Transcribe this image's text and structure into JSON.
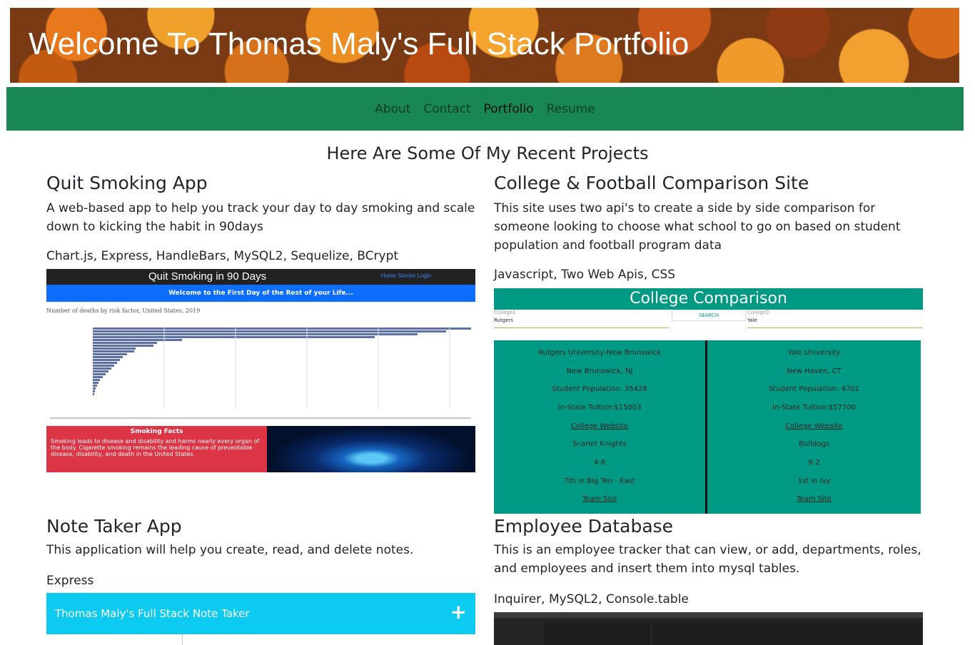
{
  "banner": {
    "title": "Welcome To Thomas Maly's Full Stack Portfolio"
  },
  "nav": {
    "items": [
      "About",
      "Contact",
      "Portfolio",
      "Resume"
    ]
  },
  "section_title": "Here Are Some Of My Recent Projects",
  "projects": [
    {
      "title": "Quit Smoking App",
      "description": "A web-based app to help you track your day to day smoking and scale down to kicking the habit in 90days",
      "tech": "Chart.js, Express, HandleBars, MySQL2, Sequelize, BCrypt"
    },
    {
      "title": "College & Football Comparison Site",
      "description": "This site uses two api's to create a side by side comparison for someone looking to choose what school to go on based on student population and football program data",
      "tech": "Javascript, Two Web Apis, CSS"
    },
    {
      "title": "Note Taker App",
      "description": "This application will help you create, read, and delete notes.",
      "tech": "Express"
    },
    {
      "title": "Employee Database",
      "description": "This is an employee tracker that can view, or add, departments, roles, and employees and insert them into mysql tables.",
      "tech": "Inquirer, MySQL2, Console.table"
    }
  ],
  "quit_smoking_shot": {
    "app_title": "Quit Smoking in 90 Days",
    "links": "Home   Stories   Login",
    "welcome": "Welcome to the First Day of the Rest of your Life...",
    "chart_title": "Number of deaths by risk factor, United States, 2019",
    "facts_heading": "Smoking Facts",
    "facts_text": "Smoking leads to disease and disability and harms nearly every organ of the body. Cigarette smoking remains the leading cause of preventable disease, disability, and death in the United States."
  },
  "college_shot": {
    "title": "College Comparison",
    "college1_label": "College1",
    "college1_value": "Rutgers",
    "search_label": "SEARCH",
    "college2_label": "College2",
    "college2_value": "Yale",
    "left": [
      "Rutgers University-New Brunswick",
      "New Brunswick, NJ",
      "Student Population: 35428",
      "In-State Tuition:$15003",
      "College Website",
      "Scarlet Knights",
      "4-8",
      "7th in Big Ten - East",
      "Team Site"
    ],
    "right": [
      "Yale University",
      "New Haven, CT",
      "Student Population: 4701",
      "In-State Tuition:$57700",
      "College Website",
      "Bulldogs",
      "8-2",
      "1st in Ivy",
      "Team Site"
    ]
  },
  "note_taker_shot": {
    "title": "Thomas Maly's Full Stack Note Taker",
    "add_icon": "plus-icon"
  },
  "colors": {
    "nav": "#198754",
    "teal": "#009a84",
    "note": "#0dcaf0",
    "danger": "#dc3545",
    "primary": "#0d6efd"
  }
}
